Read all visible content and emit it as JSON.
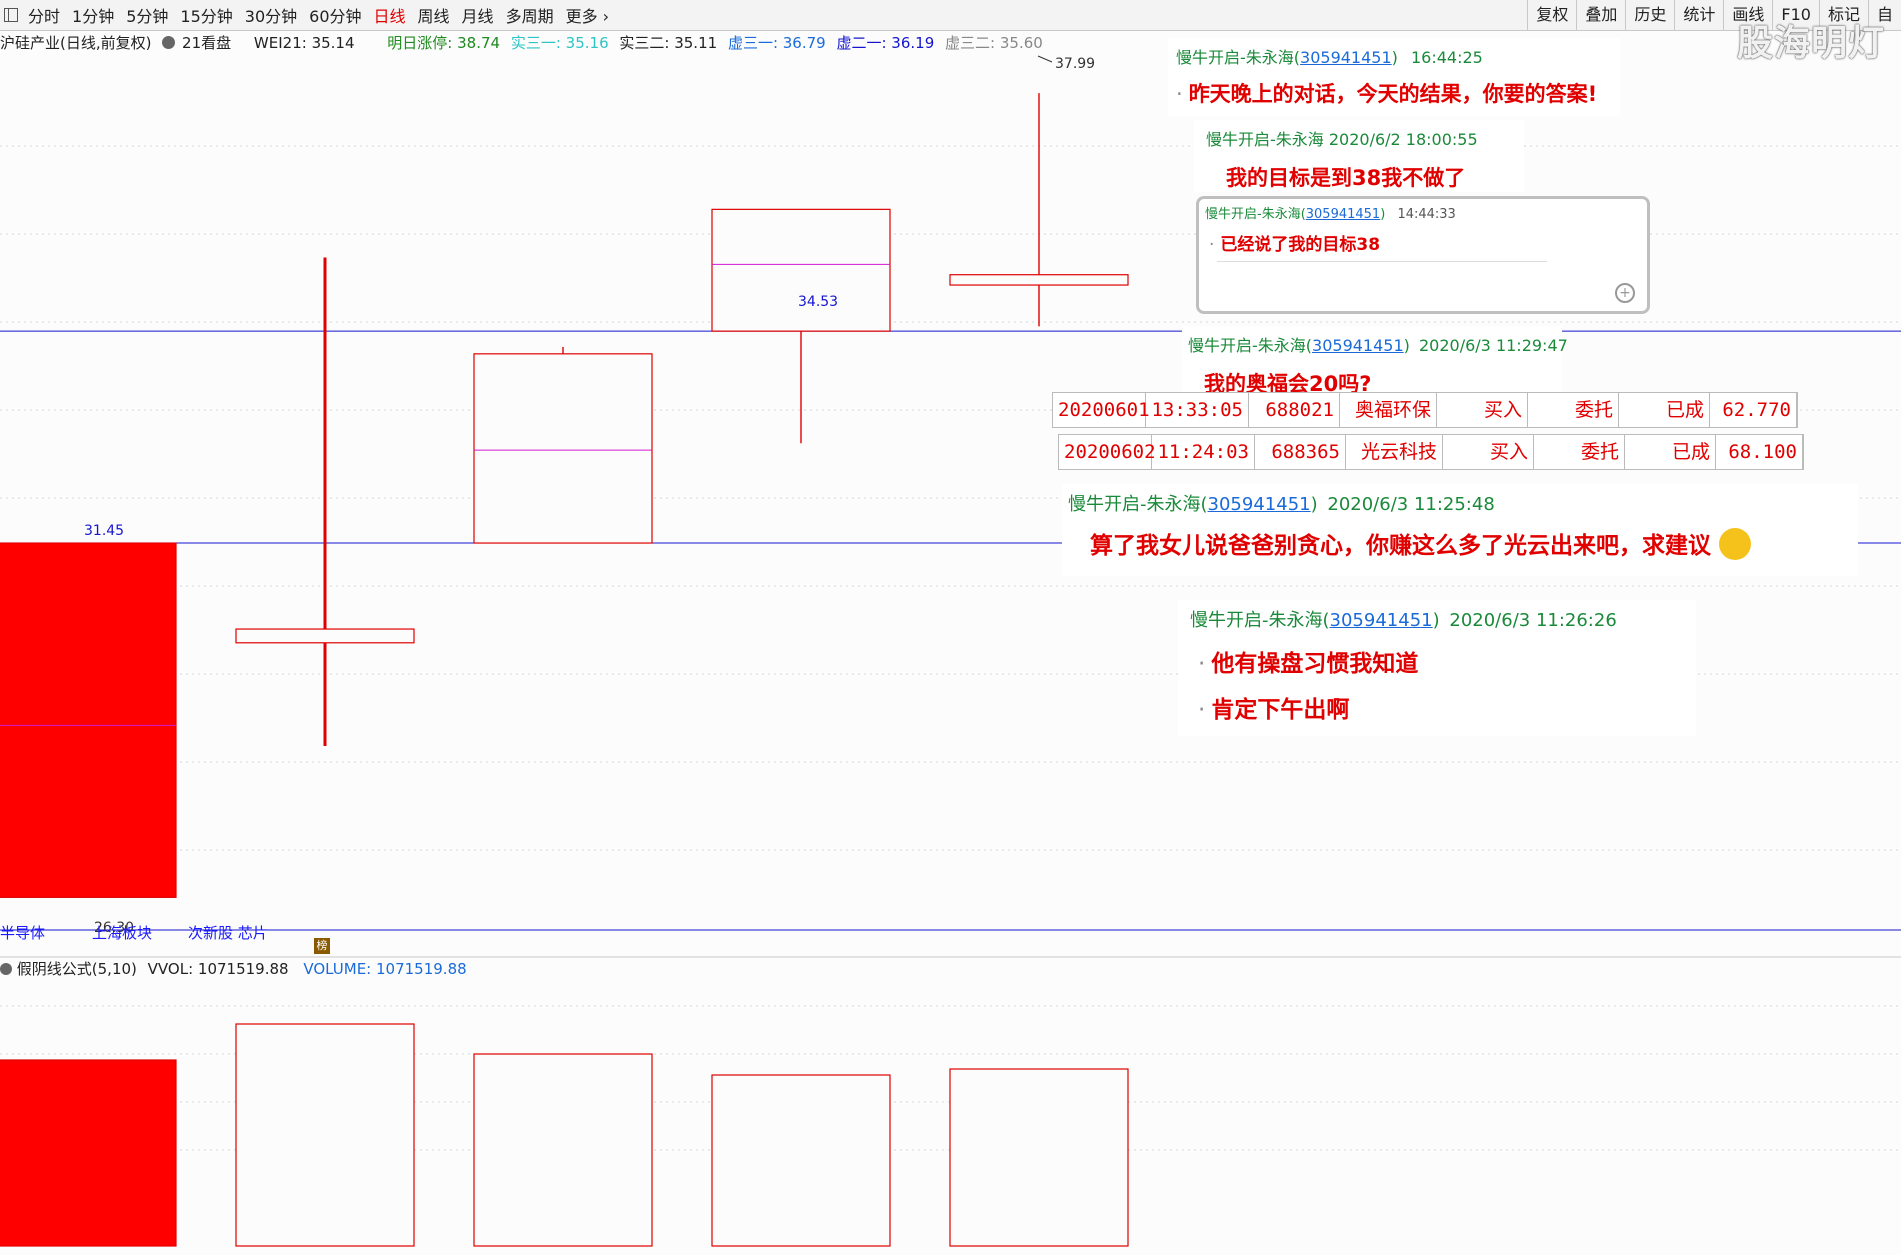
{
  "toolbar": {
    "periods": [
      "分时",
      "1分钟",
      "5分钟",
      "15分钟",
      "30分钟",
      "60分钟",
      "日线",
      "周线",
      "月线",
      "多周期",
      "更多"
    ],
    "active": "日线",
    "right": [
      "复权",
      "叠加",
      "历史",
      "统计",
      "画线",
      "F10",
      "标记",
      "自"
    ]
  },
  "info": {
    "title": "沪硅产业(日线,前复权)",
    "kanpan": "21看盘",
    "wei": "WEI21: 35.14",
    "mingri": "明日涨停: 38.74",
    "shi31": "实三一: 35.16",
    "shi32": "实三二: 35.11",
    "xu31": "虚三一: 36.79",
    "xu21": "虚二一: 36.19",
    "xu32": "虚三二: 35.60"
  },
  "price_labels": {
    "high": "37.99",
    "line_3453": "34.53",
    "line_3145": "31.45",
    "low": "26.30"
  },
  "sectors": [
    "半导体",
    "上海板块",
    "次新股 芯片"
  ],
  "bang": "榜",
  "volume": {
    "formula": "假阴线公式(5,10)",
    "vvol": "VVOL: 1071519.88",
    "vol": "VOLUME: 1071519.88"
  },
  "watermark": "股海明灯",
  "chat": [
    {
      "name": "慢牛开启-朱永海(",
      "num": "305941451",
      "close": ")",
      "time": "16:44:25",
      "msg": "昨天晚上的对话，今天的结果，你要的答案!"
    },
    {
      "name": "慢牛开启-朱永海 2020/6/2 18:00:55",
      "msg": "我的目标是到38我不做了"
    },
    {
      "name": "慢牛开启-朱永海(",
      "num": "305941451",
      "close": ")",
      "time": "14:44:33",
      "msg": "已经说了我的目标38"
    },
    {
      "name": "慢牛开启-朱永海(",
      "num": "305941451",
      "close": ")",
      "time": "2020/6/3 11:29:47",
      "msg": "我的奥福会20吗?"
    },
    {
      "name": "慢牛开启-朱永海(",
      "num": "305941451",
      "close": ")",
      "time": "2020/6/3 11:25:48",
      "msg": "算了我女儿说爸爸别贪心，你赚这么多了光云出来吧，求建议"
    },
    {
      "name": "慢牛开启-朱永海(",
      "num": "305941451",
      "close": ")",
      "time": "2020/6/3 11:26:26",
      "msg": "他有操盘习惯我知道",
      "msg2": "肯定下午出啊"
    }
  ],
  "trades": [
    [
      "20200601",
      "13:33:05",
      "688021",
      "奥福环保",
      "买入",
      "委托",
      "已成",
      "62.770"
    ],
    [
      "20200602",
      "11:24:03",
      "688365",
      "光云科技",
      "买入",
      "委托",
      "已成",
      "68.100"
    ]
  ],
  "chart_data": {
    "type": "candlestick",
    "price_axis": {
      "min": 26.0,
      "max": 38.5
    },
    "candles": [
      {
        "open": 31.45,
        "close": 26.3,
        "high": 31.45,
        "low": 26.3
      },
      {
        "open": 30.0,
        "close": 30.2,
        "high": 35.6,
        "low": 28.5
      },
      {
        "open": 31.45,
        "close": 34.2,
        "high": 34.3,
        "low": 31.45
      },
      {
        "open": 34.53,
        "close": 36.3,
        "high": 36.3,
        "low": 32.9
      },
      {
        "open": 35.2,
        "close": 35.35,
        "high": 37.99,
        "low": 34.6
      }
    ],
    "mid_lines": [
      28.8,
      null,
      32.8,
      35.5,
      null
    ],
    "hlines": [
      34.53,
      31.45
    ],
    "volume": [
      0.62,
      0.74,
      0.64,
      0.57,
      0.59
    ]
  }
}
